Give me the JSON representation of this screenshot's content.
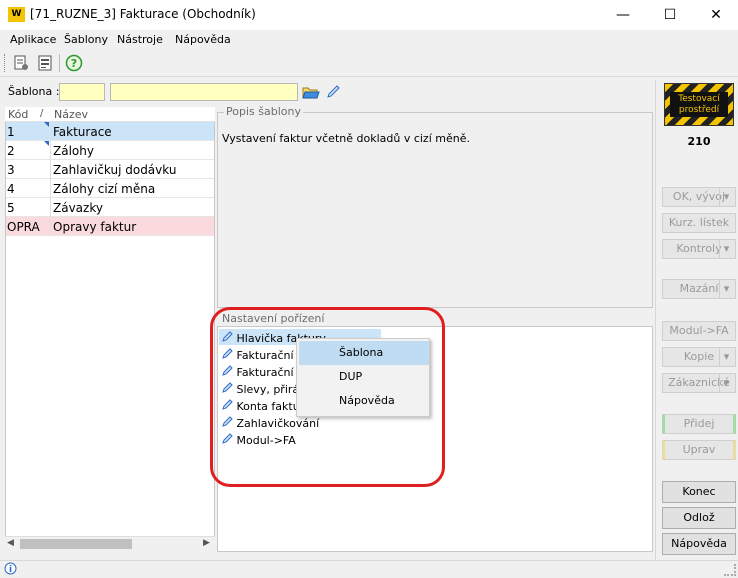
{
  "window": {
    "title": "[71_RUZNE_3] Fakturace (Obchodník)",
    "logo_text": "W",
    "minimize_glyph": "—",
    "maximize_glyph": "☐",
    "close_glyph": "✕"
  },
  "menu": [
    "Aplikace",
    "Šablony",
    "Nástroje",
    "Nápověda"
  ],
  "sablona": {
    "label": "Šablona :",
    "code_value": "",
    "name_value": ""
  },
  "list": {
    "headers": {
      "kod": "Kód",
      "sort": "/",
      "nazev": "Název"
    },
    "rows": [
      {
        "kod": "1",
        "nazev": "Fakturace"
      },
      {
        "kod": "2",
        "nazev": "Zálohy"
      },
      {
        "kod": "3",
        "nazev": "Zahlavičkuj dodávku"
      },
      {
        "kod": "4",
        "nazev": "Zálohy cizí měna"
      },
      {
        "kod": "5",
        "nazev": "Závazky"
      },
      {
        "kod": "OPRA",
        "nazev": "Opravy faktur"
      }
    ]
  },
  "popis": {
    "title": "Popis šablony",
    "text": "Vystavení faktur včetně dokladů v cizí měně."
  },
  "nastaveni": {
    "title": "Nastavení pořízení",
    "items": [
      "Hlavička faktury",
      "Fakturační d",
      "Fakturační p",
      "Slevy, přiráž",
      "Konta faktur",
      "Zahlavičkování",
      "Modul->FA"
    ]
  },
  "context_menu": [
    "Šablona",
    "DUP",
    "Nápověda"
  ],
  "badge": {
    "line1": "Testovací",
    "line2": "prostředí",
    "number": "210"
  },
  "side_buttons": {
    "ok": "OK, vývoj",
    "kurz": "Kurz. lístek",
    "kontroly": "Kontroly",
    "mazani": "Mazání",
    "modul": "Modul->FA",
    "kopie": "Kopie",
    "zakaznicke": "Zákaznické",
    "pridej": "Přidej",
    "uprav": "Uprav",
    "konec": "Konec",
    "odloz": "Odlož",
    "napoveda": "Nápověda"
  },
  "colors": {
    "selected_row": "#cce4f7",
    "opra_row": "#fadadd",
    "input_bg": "#ffffc0",
    "highlight_ring": "#e02020"
  }
}
